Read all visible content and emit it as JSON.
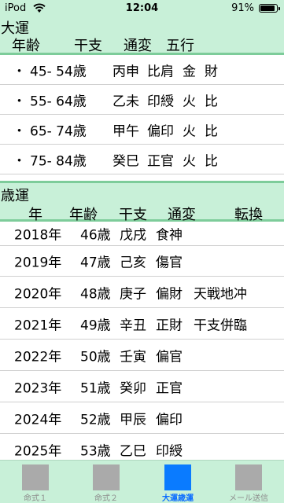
{
  "status": {
    "carrier": "iPod",
    "time": "12:04",
    "battery": "91%"
  },
  "daiun": {
    "title": "大運",
    "headers": {
      "age": "年齢",
      "kanshi": "干支",
      "tsuhen": "通変",
      "gogyo": "五行"
    },
    "rows": [
      {
        "bullet": "・",
        "age": "45- 54歳",
        "kanshi": "丙申",
        "tsuhen": "比肩",
        "g1": "金",
        "g2": "財"
      },
      {
        "bullet": "・",
        "age": "55- 64歳",
        "kanshi": "乙未",
        "tsuhen": "印綬",
        "g1": "火",
        "g2": "比"
      },
      {
        "bullet": "・",
        "age": "65- 74歳",
        "kanshi": "甲午",
        "tsuhen": "偏印",
        "g1": "火",
        "g2": "比"
      },
      {
        "bullet": "・",
        "age": "75- 84歳",
        "kanshi": "癸巳",
        "tsuhen": "正官",
        "g1": "火",
        "g2": "比"
      }
    ]
  },
  "saiun": {
    "title": "歳運",
    "headers": {
      "year": "年",
      "age": "年齢",
      "kanshi": "干支",
      "tsuhen": "通変",
      "tenkan": "転換"
    },
    "rows": [
      {
        "year": "2018年",
        "age": "46歳",
        "kanshi": "戊戌",
        "tsuhen": "食神",
        "tenkan": ""
      },
      {
        "year": "2019年",
        "age": "47歳",
        "kanshi": "己亥",
        "tsuhen": "傷官",
        "tenkan": ""
      },
      {
        "year": "2020年",
        "age": "48歳",
        "kanshi": "庚子",
        "tsuhen": "偏財",
        "tenkan": "天戦地冲"
      },
      {
        "year": "2021年",
        "age": "49歳",
        "kanshi": "辛丑",
        "tsuhen": "正財",
        "tenkan": "干支併臨"
      },
      {
        "year": "2022年",
        "age": "50歳",
        "kanshi": "壬寅",
        "tsuhen": "偏官",
        "tenkan": ""
      },
      {
        "year": "2023年",
        "age": "51歳",
        "kanshi": "癸卯",
        "tsuhen": "正官",
        "tenkan": ""
      },
      {
        "year": "2024年",
        "age": "52歳",
        "kanshi": "甲辰",
        "tsuhen": "偏印",
        "tenkan": ""
      },
      {
        "year": "2025年",
        "age": "53歳",
        "kanshi": "乙巳",
        "tsuhen": "印綬",
        "tenkan": ""
      }
    ]
  },
  "tabs": [
    {
      "label": "命式１",
      "active": false
    },
    {
      "label": "命式２",
      "active": false
    },
    {
      "label": "大運歳運",
      "active": true
    },
    {
      "label": "メール送信",
      "active": false
    }
  ],
  "colors": {
    "header_bg": "#c8f0d8",
    "header_rule": "#7dcc9a",
    "active_tab": "#0a7bff"
  }
}
